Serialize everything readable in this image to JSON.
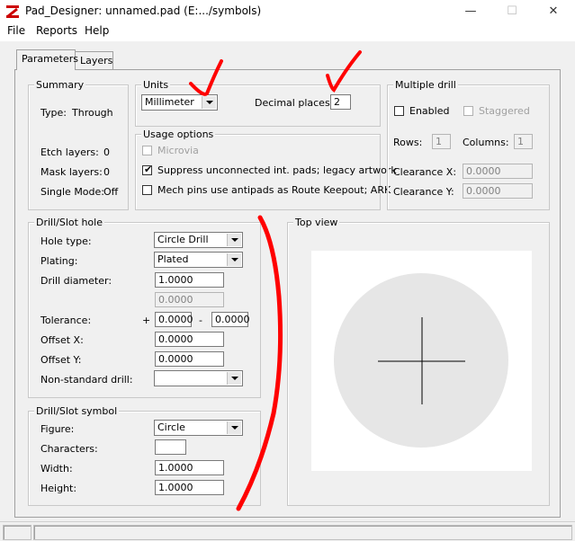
{
  "window": {
    "title": "Pad_Designer: unnamed.pad  (E:.../symbols)",
    "minimize": "—",
    "maximize": "☐",
    "close": "✕"
  },
  "menu": {
    "file": "File",
    "reports": "Reports",
    "help": "Help"
  },
  "tabs": {
    "parameters": "Parameters",
    "layers": "Layers"
  },
  "summary": {
    "title": "Summary",
    "type_label": "Type:",
    "type_value": "Through",
    "etch_label": "Etch layers:",
    "etch_value": "0",
    "mask_label": "Mask layers:",
    "mask_value": "0",
    "single_label": "Single Mode:",
    "single_value": "Off"
  },
  "units": {
    "title": "Units",
    "selected": "Millimeter",
    "decimal_label": "Decimal places:",
    "decimal_value": "2"
  },
  "usage": {
    "title": "Usage options",
    "microvia": "Microvia",
    "microvia_checked": false,
    "suppress": "Suppress unconnected int. pads; legacy artwork",
    "suppress_checked": true,
    "mech": "Mech pins use antipads as Route Keepout; ARK",
    "mech_checked": false
  },
  "multiple_drill": {
    "title": "Multiple drill",
    "enabled": "Enabled",
    "staggered": "Staggered",
    "rows_label": "Rows:",
    "rows_value": "1",
    "columns_label": "Columns:",
    "columns_value": "1",
    "clearance_x_label": "Clearance X:",
    "clearance_x_value": "0.0000",
    "clearance_y_label": "Clearance Y:",
    "clearance_y_value": "0.0000"
  },
  "drill_hole": {
    "title": "Drill/Slot hole",
    "hole_type_label": "Hole type:",
    "hole_type_value": "Circle Drill",
    "plating_label": "Plating:",
    "plating_value": "Plated",
    "diameter_label": "Drill diameter:",
    "diameter_value": "1.0000",
    "diameter2_value": "0.0000",
    "tolerance_label": "Tolerance:",
    "tol_plus": "+",
    "tol_plus_value": "0.0000",
    "tol_minus": "-",
    "tol_minus_value": "0.0000",
    "offset_x_label": "Offset X:",
    "offset_x_value": "0.0000",
    "offset_y_label": "Offset Y:",
    "offset_y_value": "0.0000",
    "nonstd_label": "Non-standard drill:",
    "nonstd_value": ""
  },
  "drill_symbol": {
    "title": "Drill/Slot symbol",
    "figure_label": "Figure:",
    "figure_value": "Circle",
    "characters_label": "Characters:",
    "characters_value": "",
    "width_label": "Width:",
    "width_value": "1.0000",
    "height_label": "Height:",
    "height_value": "1.0000"
  },
  "top_view": {
    "title": "Top view"
  },
  "colors": {
    "annotation": "#ff0000",
    "preview_circle": "#e6e6e6"
  }
}
